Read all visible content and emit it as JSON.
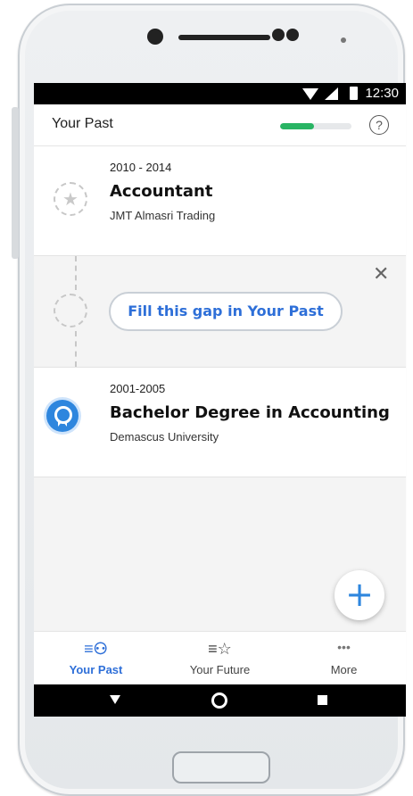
{
  "status_bar": {
    "time": "12:30"
  },
  "header": {
    "title": "Your Past",
    "progress_fraction": 0.47,
    "help_icon_glyph": "?"
  },
  "entries": [
    {
      "years": "2010 - 2014",
      "role": "Accountant",
      "organization": "JMT Almasri Trading",
      "icon": "star-icon"
    },
    {
      "years": "2001-2005",
      "role": "Bachelor Degree in Accounting",
      "organization": "Demascus University",
      "icon": "award-badge-icon"
    }
  ],
  "gap": {
    "button_label": "Fill this gap in Your Past",
    "close_glyph": "✕"
  },
  "fab": {
    "glyph": "+"
  },
  "tabs": [
    {
      "label": "Your Past",
      "icon": "person-list-icon",
      "glyph": "≡⚇"
    },
    {
      "label": "Your Future",
      "icon": "star-list-icon",
      "glyph": "≡☆"
    },
    {
      "label": "More",
      "icon": "more-dots-icon",
      "glyph": "•••"
    }
  ],
  "colors": {
    "accent": "#2e6fd8",
    "progress": "#28b463",
    "nav_bar": "#000000"
  }
}
